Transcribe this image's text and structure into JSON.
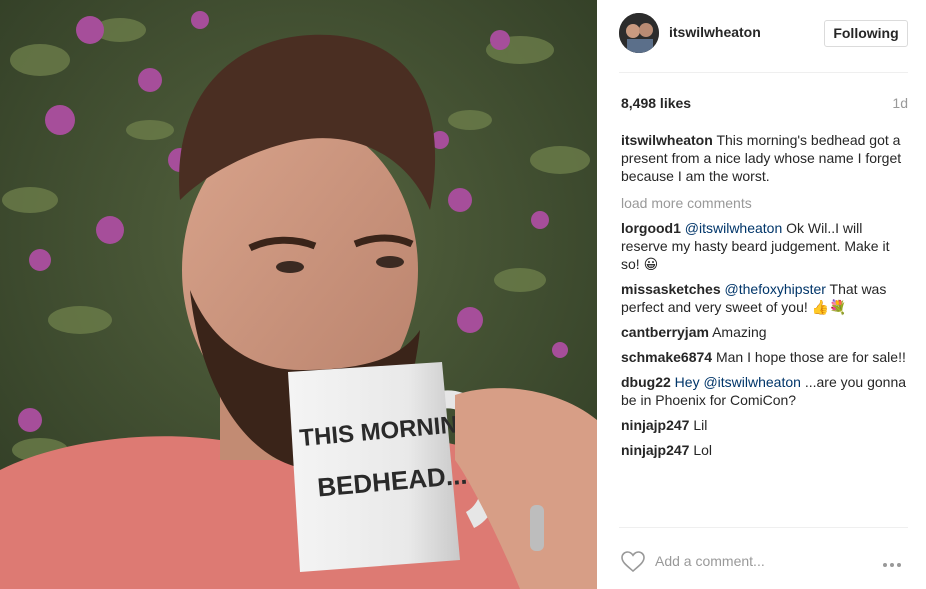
{
  "post": {
    "author": "itswilwheaton",
    "follow_button": "Following",
    "likes": "8,498 likes",
    "age": "1d",
    "caption_text": "This morning's bedhead got a present from a nice lady whose name I forget because I am the worst.",
    "mug_text_line1": "THIS MORNING'S",
    "mug_text_line2": "BEDHEAD..."
  },
  "load_more": "load more comments",
  "comments": [
    {
      "user": "lorgood1",
      "mention": "@itswilwheaton",
      "text": " Ok Wil..I will reserve my hasty beard judgement. Make it so! 😀"
    },
    {
      "user": "missasketches",
      "mention": "@thefoxyhipster",
      "text": " That was perfect and very sweet of you! 👍💐"
    },
    {
      "user": "cantberryjam",
      "mention": "",
      "text": "Amazing"
    },
    {
      "user": "schmake6874",
      "mention": "",
      "text": "Man I hope those are for sale!!"
    },
    {
      "user": "dbug22",
      "mention": "Hey @itswilwheaton",
      "text": " ...are you gonna be in Phoenix for ComiCon?"
    },
    {
      "user": "ninjajp247",
      "mention": "",
      "text": "Lil"
    },
    {
      "user": "ninjajp247",
      "mention": "",
      "text": "Lol"
    }
  ],
  "add_comment_placeholder": "Add a comment...",
  "icons": {
    "like": "heart-icon",
    "more": "more-options-icon"
  }
}
